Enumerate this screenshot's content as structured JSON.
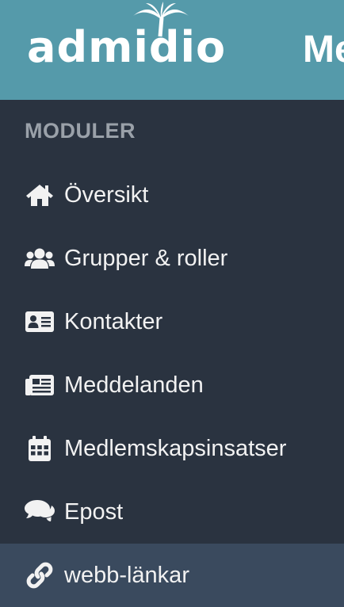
{
  "header": {
    "logo_text": "admidio",
    "site_title": "Me"
  },
  "sidebar": {
    "section_title": "MODULER",
    "items": [
      {
        "label": "Översikt",
        "icon": "home-icon"
      },
      {
        "label": "Grupper & roller",
        "icon": "users-icon"
      },
      {
        "label": "Kontakter",
        "icon": "address-card-icon"
      },
      {
        "label": "Meddelanden",
        "icon": "newspaper-icon"
      },
      {
        "label": "Medlemskapsinsatser",
        "icon": "calendar-icon"
      },
      {
        "label": "Epost",
        "icon": "comments-icon"
      },
      {
        "label": "webb-länkar",
        "icon": "link-icon",
        "active": true
      }
    ]
  },
  "colors": {
    "header_bg": "#559aaa",
    "sidebar_bg": "#2a3340",
    "active_bg": "#3a4a5e",
    "section_title": "#9aa1a9"
  }
}
